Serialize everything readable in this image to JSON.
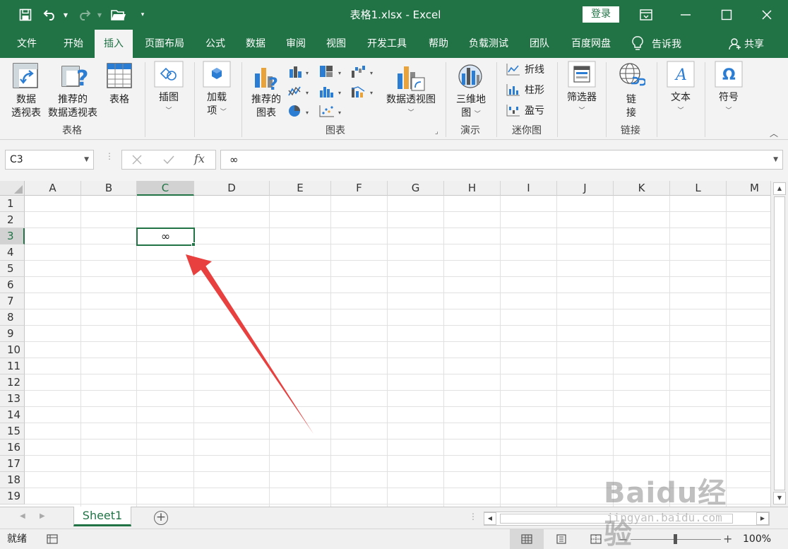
{
  "window": {
    "title": "表格1.xlsx  -  Excel",
    "login": "登录"
  },
  "tabs": [
    "文件",
    "开始",
    "插入",
    "页面布局",
    "公式",
    "数据",
    "审阅",
    "视图",
    "开发工具",
    "帮助",
    "负载测试",
    "团队",
    "百度网盘"
  ],
  "active_tab": "插入",
  "tell_me": "告诉我",
  "share": "共享",
  "ribbon": {
    "pivot_table": [
      "数据",
      "透视表"
    ],
    "recommended_pivot": [
      "推荐的",
      "数据透视表"
    ],
    "table": "表格",
    "group_tables": "表格",
    "illustrations": "插图",
    "addins": [
      "加载",
      "项"
    ],
    "recommended_charts": [
      "推荐的",
      "图表"
    ],
    "pivot_chart": "数据透视图",
    "group_charts": "图表",
    "map_3d": [
      "三维地",
      "图"
    ],
    "group_tours": "演示",
    "spark_line": "折线",
    "spark_column": "柱形",
    "spark_winloss": "盈亏",
    "group_sparklines": "迷你图",
    "slicer": "筛选器",
    "link": [
      "链",
      "接"
    ],
    "group_links": "链接",
    "text": "文本",
    "symbol": "符号"
  },
  "formula_bar": {
    "name_box": "C3",
    "fx": "fx",
    "content": "∞"
  },
  "grid": {
    "columns": [
      "A",
      "B",
      "C",
      "D",
      "E",
      "F",
      "G",
      "H",
      "I",
      "J",
      "K",
      "L",
      "M"
    ],
    "rows": [
      "1",
      "2",
      "3",
      "4",
      "5",
      "6",
      "7",
      "8",
      "9",
      "10",
      "11",
      "12",
      "13",
      "14",
      "15",
      "16",
      "17",
      "18",
      "19"
    ],
    "active_column": "C",
    "active_row": "3",
    "active_cell_value": "∞"
  },
  "sheets": [
    "Sheet1"
  ],
  "status": {
    "ready": "就绪",
    "zoom": "100%"
  },
  "watermark": {
    "main": "Baidu经验",
    "sub": "jingyan.baidu.com"
  },
  "colors": {
    "accent": "#217346",
    "arrow": "#e8403f"
  }
}
